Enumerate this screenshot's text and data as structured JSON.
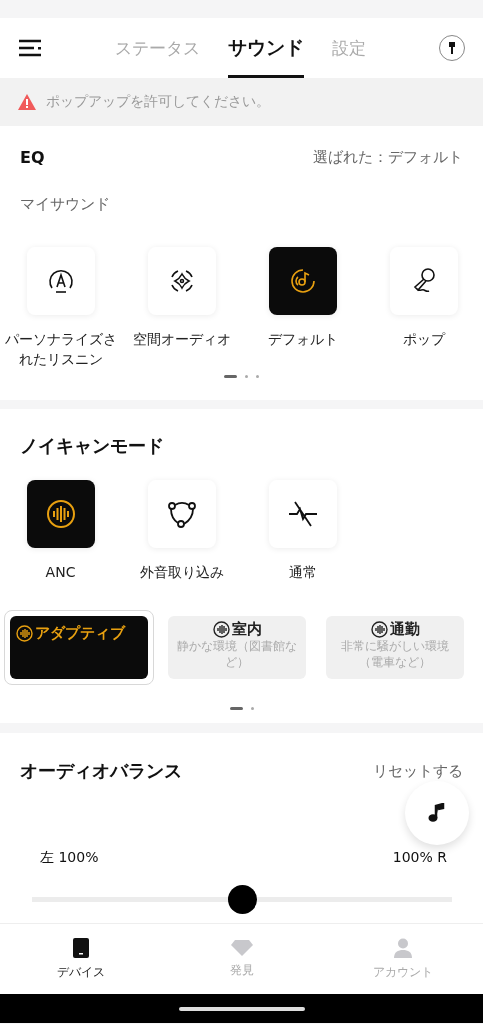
{
  "tabs": [
    {
      "label": "ステータス",
      "selected": false
    },
    {
      "label": "サウンド",
      "selected": true
    },
    {
      "label": "設定",
      "selected": false
    }
  ],
  "banner": {
    "text": "ポップアップを許可してください。"
  },
  "eq": {
    "title": "EQ",
    "selected_label": "選ばれた：デフォルト",
    "subtitle": "マイサウンド",
    "presets": [
      {
        "kind": "personal",
        "label": "パーソナライズされたリスニン",
        "selected": false
      },
      {
        "kind": "spatial",
        "label": "空間オーディオ",
        "selected": false
      },
      {
        "kind": "music",
        "label": "デフォルト",
        "selected": true
      },
      {
        "kind": "mic",
        "label": "ポップ",
        "selected": false
      }
    ],
    "pages": [
      {
        "selected": true
      },
      {
        "selected": false
      },
      {
        "selected": false
      }
    ]
  },
  "noise": {
    "title": "ノイキャンモード",
    "modes": [
      {
        "kind": "anc",
        "label": "ANC",
        "selected": true
      },
      {
        "kind": "ambient",
        "label": "外音取り込み",
        "selected": false
      },
      {
        "kind": "normal",
        "label": "通常",
        "selected": false
      }
    ],
    "submodes": [
      {
        "title": "アダプティブ",
        "selected": true
      },
      {
        "title": "室内",
        "description": "静かな環境（図書館など）",
        "selected": false
      },
      {
        "title": "通勤",
        "description": "非常に騒がしい環境（電車など）",
        "selected": false
      }
    ],
    "pages": [
      {
        "selected": true
      },
      {
        "selected": false
      }
    ]
  },
  "balance": {
    "title": "オーディオバランス",
    "reset": "リセットする",
    "left": "左 100%",
    "right": "100% R",
    "level": 0.5
  },
  "nav": [
    {
      "kind": "device",
      "label": "デバイス",
      "selected": true
    },
    {
      "kind": "discover",
      "label": "発見",
      "selected": false
    },
    {
      "kind": "account",
      "label": "アカウント",
      "selected": false
    }
  ]
}
